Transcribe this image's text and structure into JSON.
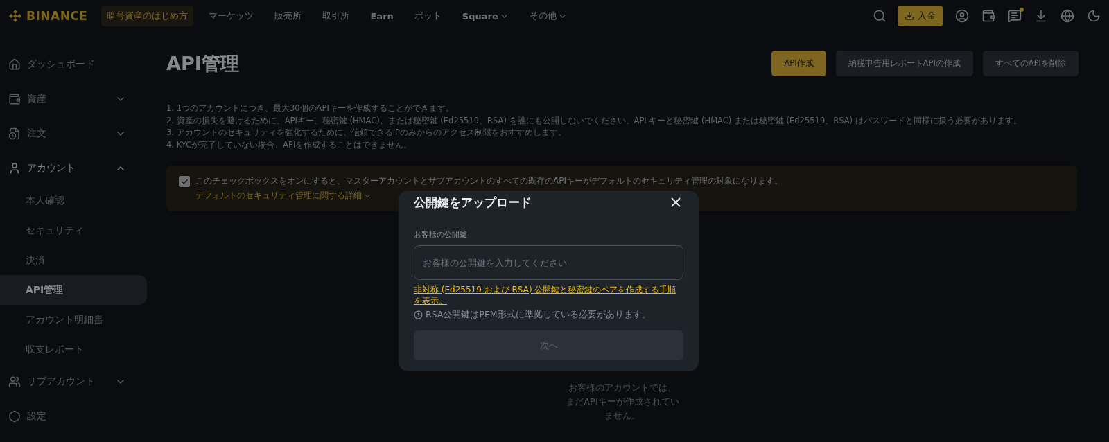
{
  "header": {
    "logo": "BINANCE",
    "promo": "暗号資産のはじめ方",
    "nav": [
      {
        "label": "マーケッツ",
        "dropdown": false
      },
      {
        "label": "販売所",
        "dropdown": false
      },
      {
        "label": "取引所",
        "dropdown": false
      },
      {
        "label": "Earn",
        "dropdown": false
      },
      {
        "label": "ボット",
        "dropdown": false
      },
      {
        "label": "Square",
        "dropdown": true
      },
      {
        "label": "その他",
        "dropdown": true
      }
    ],
    "deposit": "入金",
    "notification_dot": true
  },
  "sidebar": {
    "items": [
      {
        "kind": "link",
        "label": "ダッシュボード"
      },
      {
        "kind": "group",
        "label": "資産",
        "expanded": false
      },
      {
        "kind": "group",
        "label": "注文",
        "expanded": false
      },
      {
        "kind": "group",
        "label": "アカウント",
        "expanded": true,
        "children": [
          {
            "label": "本人確認",
            "selected": false
          },
          {
            "label": "セキュリティ",
            "selected": false
          },
          {
            "label": "決済",
            "selected": false
          },
          {
            "label": "API管理",
            "selected": true
          },
          {
            "label": "アカウント明細書",
            "selected": false
          },
          {
            "label": "収支レポート",
            "selected": false
          }
        ]
      },
      {
        "kind": "group",
        "label": "サブアカウント",
        "expanded": false
      },
      {
        "kind": "link",
        "label": "設定"
      }
    ]
  },
  "page": {
    "title": "API管理",
    "actions": [
      {
        "label": "API作成",
        "primary": true
      },
      {
        "label": "納税申告用レポートAPIの作成",
        "primary": false
      },
      {
        "label": "すべてのAPIを削除",
        "primary": false
      }
    ],
    "notes": [
      "1. 1つのアカウントにつき、最大30個のAPIキーを作成することができます。",
      "2. 資産の損失を避けるために、APIキー、秘密鍵 (HMAC)、または秘密鍵 (Ed25519、RSA) を誰にも公開しないでください。API キーと秘密鍵 (HMAC) または秘密鍵 (Ed25519、RSA) はパスワードと同様に扱う必要があります。",
      "3. アカウントのセキュリティを強化するために、信頼できるIPのみからのアクセス制限をおすすめします。",
      "4. KYCが完了していない場合、APIを作成することはできません。"
    ],
    "banner": {
      "checked": true,
      "text": "このチェックボックスをオンにすると、マスターアカウントとサブアカウントのすべての既存のAPIキーがデフォルトのセキュリティ管理の対象になります。",
      "link": "デフォルトのセキュリティ管理に関する詳細"
    },
    "empty_state": "お客様のアカウントでは、まだAPIキーが作成されていません。"
  },
  "modal": {
    "title": "公開鍵をアップロード",
    "field_label": "お客様の公開鍵",
    "placeholder": "お客様の公開鍵を入力してください",
    "link": "非対称 (Ed25519 および RSA) 公開鍵と秘密鍵のペアを作成する手順を表示。",
    "hint": "RSA公開鍵はPEM形式に準拠している必要があります。",
    "next": {
      "label": "次へ",
      "disabled": true
    }
  }
}
